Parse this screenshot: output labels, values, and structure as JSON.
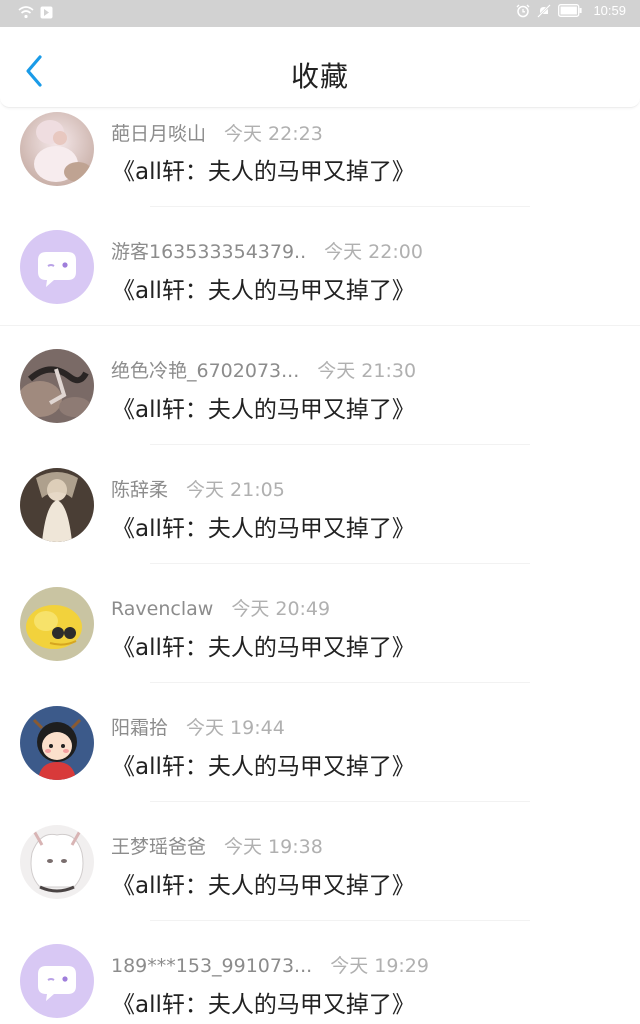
{
  "status_bar": {
    "time": "10:59",
    "icons": [
      "wifi-icon",
      "notification-icon",
      "alarm-icon",
      "mute-icon",
      "battery-icon"
    ]
  },
  "header": {
    "title": "收藏",
    "back_icon": "chevron-left-icon"
  },
  "colors": {
    "accent": "#1a9be8",
    "status_bar_bg": "#d2d2d2",
    "guest_avatar_bg": "#d8c8f4"
  },
  "items": [
    {
      "username": "葩日月啖山",
      "time": "今天 22:23",
      "book": "《all轩：夫人的马甲又掉了》",
      "avatar": "photo-avatar-pink"
    },
    {
      "username": "游客163533354379..",
      "time": "今天 22:00",
      "book": "《all轩：夫人的马甲又掉了》",
      "avatar": "guest-chat-avatar"
    },
    {
      "username": "绝色冷艳_6702073...",
      "time": "今天 21:30",
      "book": "《all轩：夫人的马甲又掉了》",
      "avatar": "photo-avatar-dark"
    },
    {
      "username": "陈辞柔",
      "time": "今天 21:05",
      "book": "《all轩：夫人的马甲又掉了》",
      "avatar": "photo-avatar-bride"
    },
    {
      "username": "Ravenclaw",
      "time": "今天 20:49",
      "book": "《all轩：夫人的马甲又掉了》",
      "avatar": "photo-avatar-chick"
    },
    {
      "username": "阳霜拾",
      "time": "今天 19:44",
      "book": "《all轩：夫人的马甲又掉了》",
      "avatar": "cartoon-avatar-girl"
    },
    {
      "username": "王梦瑶爸爸",
      "time": "今天 19:38",
      "book": "《all轩：夫人的马甲又掉了》",
      "avatar": "anime-avatar-white"
    },
    {
      "username": "189***153_991073...",
      "time": "今天 19:29",
      "book": "《all轩：夫人的马甲又掉了》",
      "avatar": "guest-chat-avatar"
    }
  ]
}
